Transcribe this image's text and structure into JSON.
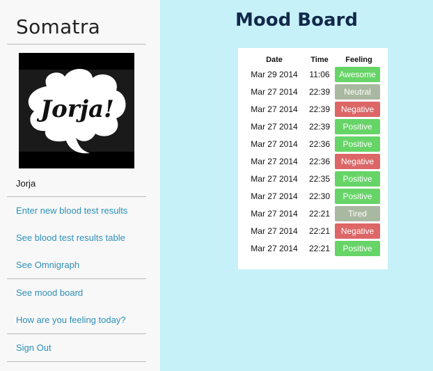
{
  "sidebar": {
    "brand": "Somatra",
    "avatar_text": "Jorja!",
    "username": "Jorja",
    "links": [
      {
        "label": "Enter new blood test results"
      },
      {
        "label": "See blood test results table"
      },
      {
        "label": "See Omnigraph"
      },
      {
        "label": "See mood board"
      },
      {
        "label": "How are you feeling today?"
      },
      {
        "label": "Sign Out"
      }
    ]
  },
  "main": {
    "title": "Mood Board",
    "columns": [
      "Date",
      "Time",
      "Feeling"
    ],
    "rows": [
      {
        "date": "Mar 29 2014",
        "time": "11:06",
        "feeling": "Awesome"
      },
      {
        "date": "Mar 27 2014",
        "time": "22:39",
        "feeling": "Neutral"
      },
      {
        "date": "Mar 27 2014",
        "time": "22:39",
        "feeling": "Negative"
      },
      {
        "date": "Mar 27 2014",
        "time": "22:39",
        "feeling": "Positive"
      },
      {
        "date": "Mar 27 2014",
        "time": "22:36",
        "feeling": "Positive"
      },
      {
        "date": "Mar 27 2014",
        "time": "22:36",
        "feeling": "Negative"
      },
      {
        "date": "Mar 27 2014",
        "time": "22:35",
        "feeling": "Positive"
      },
      {
        "date": "Mar 27 2014",
        "time": "22:30",
        "feeling": "Positive"
      },
      {
        "date": "Mar 27 2014",
        "time": "22:21",
        "feeling": "Tired"
      },
      {
        "date": "Mar 27 2014",
        "time": "22:21",
        "feeling": "Negative"
      },
      {
        "date": "Mar 27 2014",
        "time": "22:21",
        "feeling": "Positive"
      }
    ]
  },
  "colors": {
    "page_bg": "#c6f1f9",
    "title": "#13294b",
    "link": "#2d8fb8",
    "feelings": {
      "Awesome": "#66d466",
      "Positive": "#66d466",
      "Neutral": "#a9b8a0",
      "Tired": "#a9b8a0",
      "Negative": "#dd6666"
    }
  }
}
